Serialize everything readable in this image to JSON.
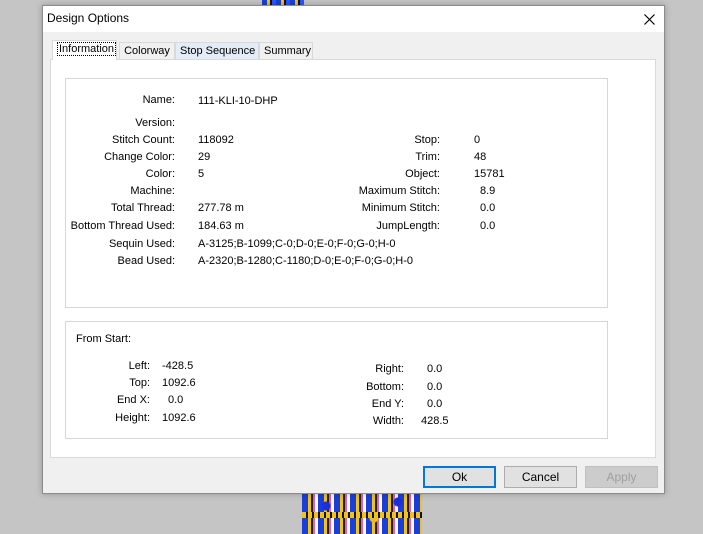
{
  "dialog": {
    "title": "Design Options",
    "tabs": [
      {
        "label": "Information"
      },
      {
        "label": "Colorway"
      },
      {
        "label": "Stop Sequence"
      },
      {
        "label": "Summary"
      }
    ]
  },
  "info": {
    "name_label": "Name:",
    "name_value": "111-KLI-10-DHP",
    "version_label": "Version:",
    "version_value": "",
    "stitch_count_label": "Stitch Count:",
    "stitch_count_value": "118092",
    "change_color_label": "Change Color:",
    "change_color_value": "29",
    "color_label": "Color:",
    "color_value": "5",
    "machine_label": "Machine:",
    "machine_value": "",
    "total_thread_label": "Total Thread:",
    "total_thread_value": "277.78 m",
    "bottom_thread_label": "Bottom Thread Used:",
    "bottom_thread_value": "184.63 m",
    "sequin_label": "Sequin Used:",
    "sequin_value": "A-3125;B-1099;C-0;D-0;E-0;F-0;G-0;H-0",
    "bead_label": "Bead Used:",
    "bead_value": "A-2320;B-1280;C-1180;D-0;E-0;F-0;G-0;H-0",
    "stop_label": "Stop:",
    "stop_value": "0",
    "trim_label": "Trim:",
    "trim_value": "48",
    "object_label": "Object:",
    "object_value": "15781",
    "max_stitch_label": "Maximum Stitch:",
    "max_stitch_value": "8.9",
    "min_stitch_label": "Minimum Stitch:",
    "min_stitch_value": "0.0",
    "jump_length_label": "JumpLength:",
    "jump_length_value": "0.0"
  },
  "from_start": {
    "heading": "From Start:",
    "left_label": "Left:",
    "left_value": "-428.5",
    "top_label": "Top:",
    "top_value": "1092.6",
    "endx_label": "End X:",
    "endx_value": "0.0",
    "height_label": "Height:",
    "height_value": "1092.6",
    "right_label": "Right:",
    "right_value": "0.0",
    "bottom_label": "Bottom:",
    "bottom_value": "0.0",
    "endy_label": "End Y:",
    "endy_value": "0.0",
    "width_label": "Width:",
    "width_value": "428.5"
  },
  "buttons": {
    "ok": "Ok",
    "cancel": "Cancel",
    "apply": "Apply"
  },
  "colors": {
    "accent": "#0078d7",
    "artwork_blue": "#1a3fd6",
    "artwork_gold": "#f0c21a"
  }
}
